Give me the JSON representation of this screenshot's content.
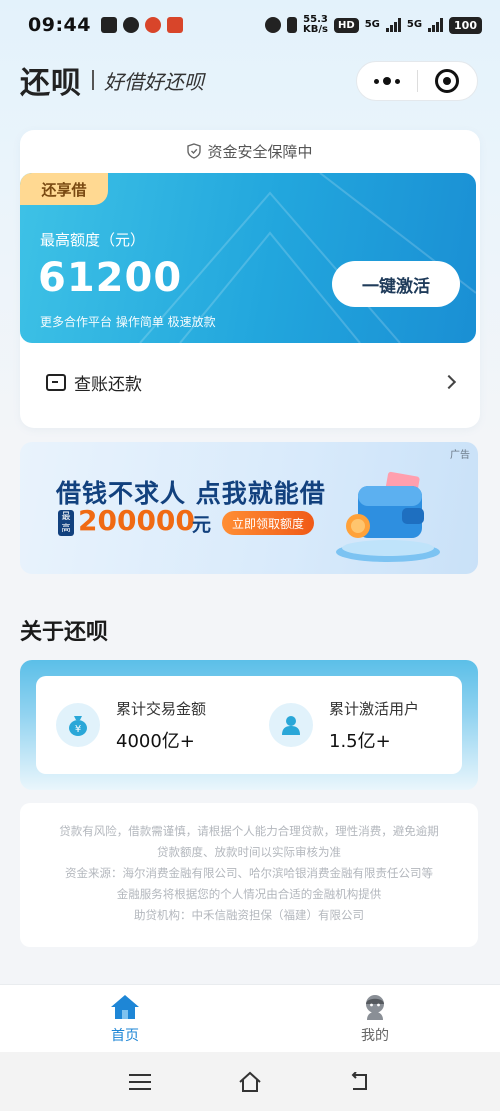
{
  "status_bar": {
    "time": "09:44",
    "net_speed": "55.3",
    "net_unit": "KB/s",
    "hd": "HD",
    "net1": "5G",
    "net2": "5G",
    "battery": "100"
  },
  "header": {
    "brand": "还呗",
    "slogan": "好借好还呗"
  },
  "card": {
    "safety_text": "资金安全保障中",
    "product_tag": "还享借",
    "limit_label": "最高额度（元）",
    "limit_amount": "61200",
    "sub_text": "更多合作平台 操作简单 极速放款",
    "activate_button": "一键激活",
    "bill_label": "查账还款"
  },
  "ad": {
    "tag": "广告",
    "headline": "借钱不求人 点我就能借",
    "max_tag": "最高",
    "amount": "200000",
    "unit": "元",
    "button": "立即领取额度"
  },
  "about": {
    "title": "关于还呗",
    "stats": [
      {
        "label": "累计交易金额",
        "value": "4000亿+",
        "icon": "money-bag-icon"
      },
      {
        "label": "累计激活用户",
        "value": "1.5亿+",
        "icon": "user-icon"
      }
    ]
  },
  "disclaimer": {
    "lines": [
      "贷款有风险，借款需谨慎，请根据个人能力合理贷款，理性消费，避免逾期",
      "贷款额度、放款时间以实际审核为准",
      "资金来源：海尔消费金融有限公司、哈尔滨哈银消费金融有限责任公司等",
      "金融服务将根据您的个人情况由合适的金融机构提供",
      "助贷机构：中禾信融资担保（福建）有限公司"
    ]
  },
  "tabbar": {
    "home": "首页",
    "mine": "我的"
  },
  "colors": {
    "accent": "#1e86d6",
    "card_gradient_start": "#3ec2e6",
    "card_gradient_end": "#1a8fd4",
    "tag_bg": "#ffd992",
    "ad_orange": "#f06a13",
    "ad_navy": "#12417e"
  }
}
